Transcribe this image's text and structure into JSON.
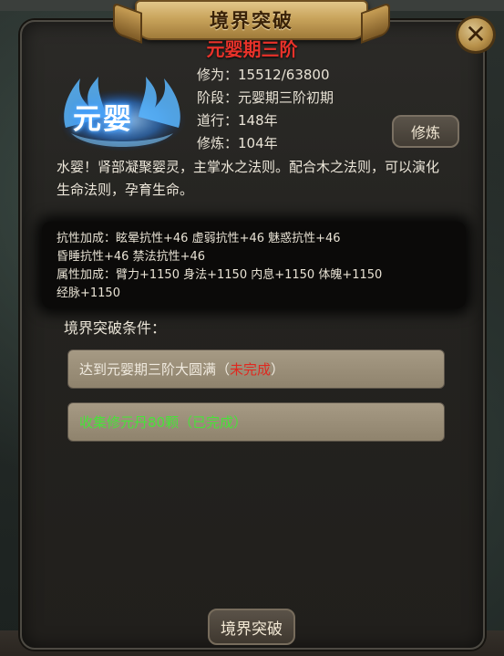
{
  "dialog": {
    "title": "境界突破",
    "subtitle": "元婴期三阶",
    "emblem_text": "元婴",
    "close_icon": "✕"
  },
  "stats": {
    "cultivation": "修为：15512/63800",
    "stage": "阶段：元婴期三阶初期",
    "dao": "道行：148年",
    "practice": "修炼：104年"
  },
  "cultivate_button": "修炼",
  "description": "水婴！肾部凝聚婴灵，主掌水之法则。配合木之法则，可以演化生命法则，孕育生命。",
  "bonuses": {
    "line1": "抗性加成：眩晕抗性+46 虚弱抗性+46 魅惑抗性+46",
    "line2": "昏睡抗性+46 禁法抗性+46",
    "line3": "属性加成：臂力+1150 身法+1150 内息+1150 体魄+1150",
    "line4": "经脉+1150"
  },
  "conditions": {
    "title": "境界突破条件：",
    "items": [
      {
        "prefix": "达到元婴期三阶大圆满（",
        "status": "未完成",
        "suffix": "）"
      },
      {
        "text": "收集修元丹80颗（已完成）"
      }
    ]
  },
  "breakthrough_button": "境界突破",
  "colors": {
    "subtitle_red": "#e8322a",
    "incomplete_red": "#e0281f",
    "complete_green": "#49e13a",
    "gold": "#c9a45c"
  }
}
